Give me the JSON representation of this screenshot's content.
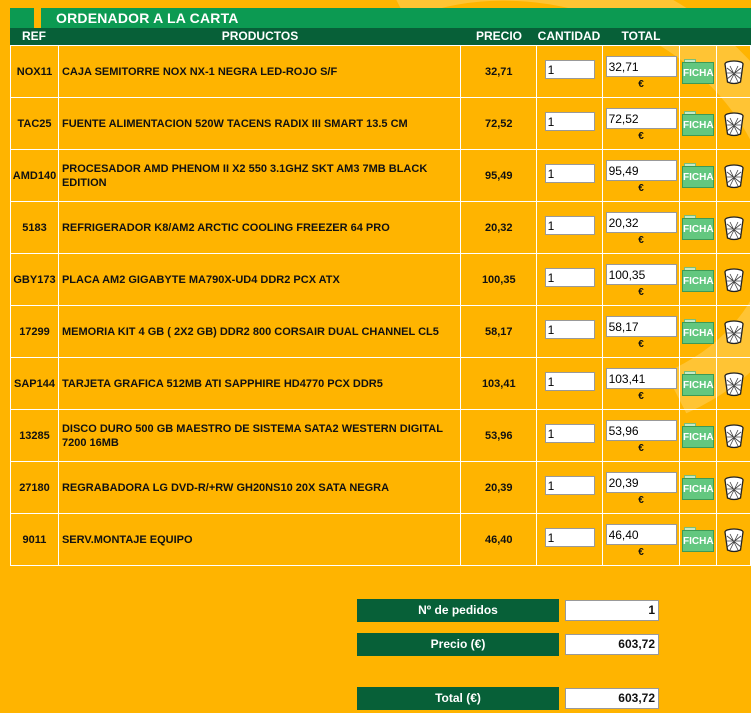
{
  "page": {
    "title": "ORDENADOR A LA CARTA"
  },
  "headers": {
    "ref": "REF",
    "productos": "PRODUCTOS",
    "precio": "PRECIO",
    "cantidad": "CANTIDAD",
    "total": "TOTAL"
  },
  "rows": [
    {
      "ref": "NOX11",
      "product": "CAJA SEMITORRE NOX NX-1 NEGRA LED-ROJO S/F",
      "price": "32,71",
      "qty": "1",
      "total": "32,71",
      "currency": "€",
      "ficha": "FICHA"
    },
    {
      "ref": "TAC25",
      "product": "FUENTE ALIMENTACION 520W TACENS RADIX III SMART 13.5 CM",
      "price": "72,52",
      "qty": "1",
      "total": "72,52",
      "currency": "€",
      "ficha": "FICHA"
    },
    {
      "ref": "AMD140",
      "product": "PROCESADOR AMD PHENOM II X2 550 3.1GHZ SKT AM3 7MB BLACK EDITION",
      "price": "95,49",
      "qty": "1",
      "total": "95,49",
      "currency": "€",
      "ficha": "FICHA"
    },
    {
      "ref": "5183",
      "product": "REFRIGERADOR K8/AM2 ARCTIC COOLING FREEZER 64 PRO",
      "price": "20,32",
      "qty": "1",
      "total": "20,32",
      "currency": "€",
      "ficha": "FICHA"
    },
    {
      "ref": "GBY173",
      "product": "PLACA AM2 GIGABYTE MA790X-UD4 DDR2 PCX ATX",
      "price": "100,35",
      "qty": "1",
      "total": "100,35",
      "currency": "€",
      "ficha": "FICHA"
    },
    {
      "ref": "17299",
      "product": "MEMORIA KIT 4 GB ( 2X2 GB) DDR2 800 CORSAIR DUAL CHANNEL CL5",
      "price": "58,17",
      "qty": "1",
      "total": "58,17",
      "currency": "€",
      "ficha": "FICHA"
    },
    {
      "ref": "SAP144",
      "product": "TARJETA GRAFICA 512MB ATI SAPPHIRE HD4770 PCX DDR5",
      "price": "103,41",
      "qty": "1",
      "total": "103,41",
      "currency": "€",
      "ficha": "FICHA"
    },
    {
      "ref": "13285",
      "product": "DISCO DURO 500 GB MAESTRO DE SISTEMA SATA2 WESTERN DIGITAL 7200 16MB",
      "price": "53,96",
      "qty": "1",
      "total": "53,96",
      "currency": "€",
      "ficha": "FICHA"
    },
    {
      "ref": "27180",
      "product": "REGRABADORA LG DVD-R/+RW GH20NS10 20X SATA NEGRA",
      "price": "20,39",
      "qty": "1",
      "total": "20,39",
      "currency": "€",
      "ficha": "FICHA"
    },
    {
      "ref": "9011",
      "product": "SERV.MONTAJE EQUIPO",
      "price": "46,40",
      "qty": "1",
      "total": "46,40",
      "currency": "€",
      "ficha": "FICHA"
    }
  ],
  "summary": {
    "num_pedidos_label": "Nº de pedidos",
    "num_pedidos_value": "1",
    "precio_label": "Precio (€)",
    "precio_value": "603,72",
    "total_label": "Total (€)",
    "total_value": "603,72"
  },
  "colors": {
    "background": "#FFB400",
    "title_green": "#0C9A52",
    "dark_green": "#076038"
  },
  "icons": {
    "ficha": "folder-ficha-icon",
    "delete": "trash-icon"
  }
}
